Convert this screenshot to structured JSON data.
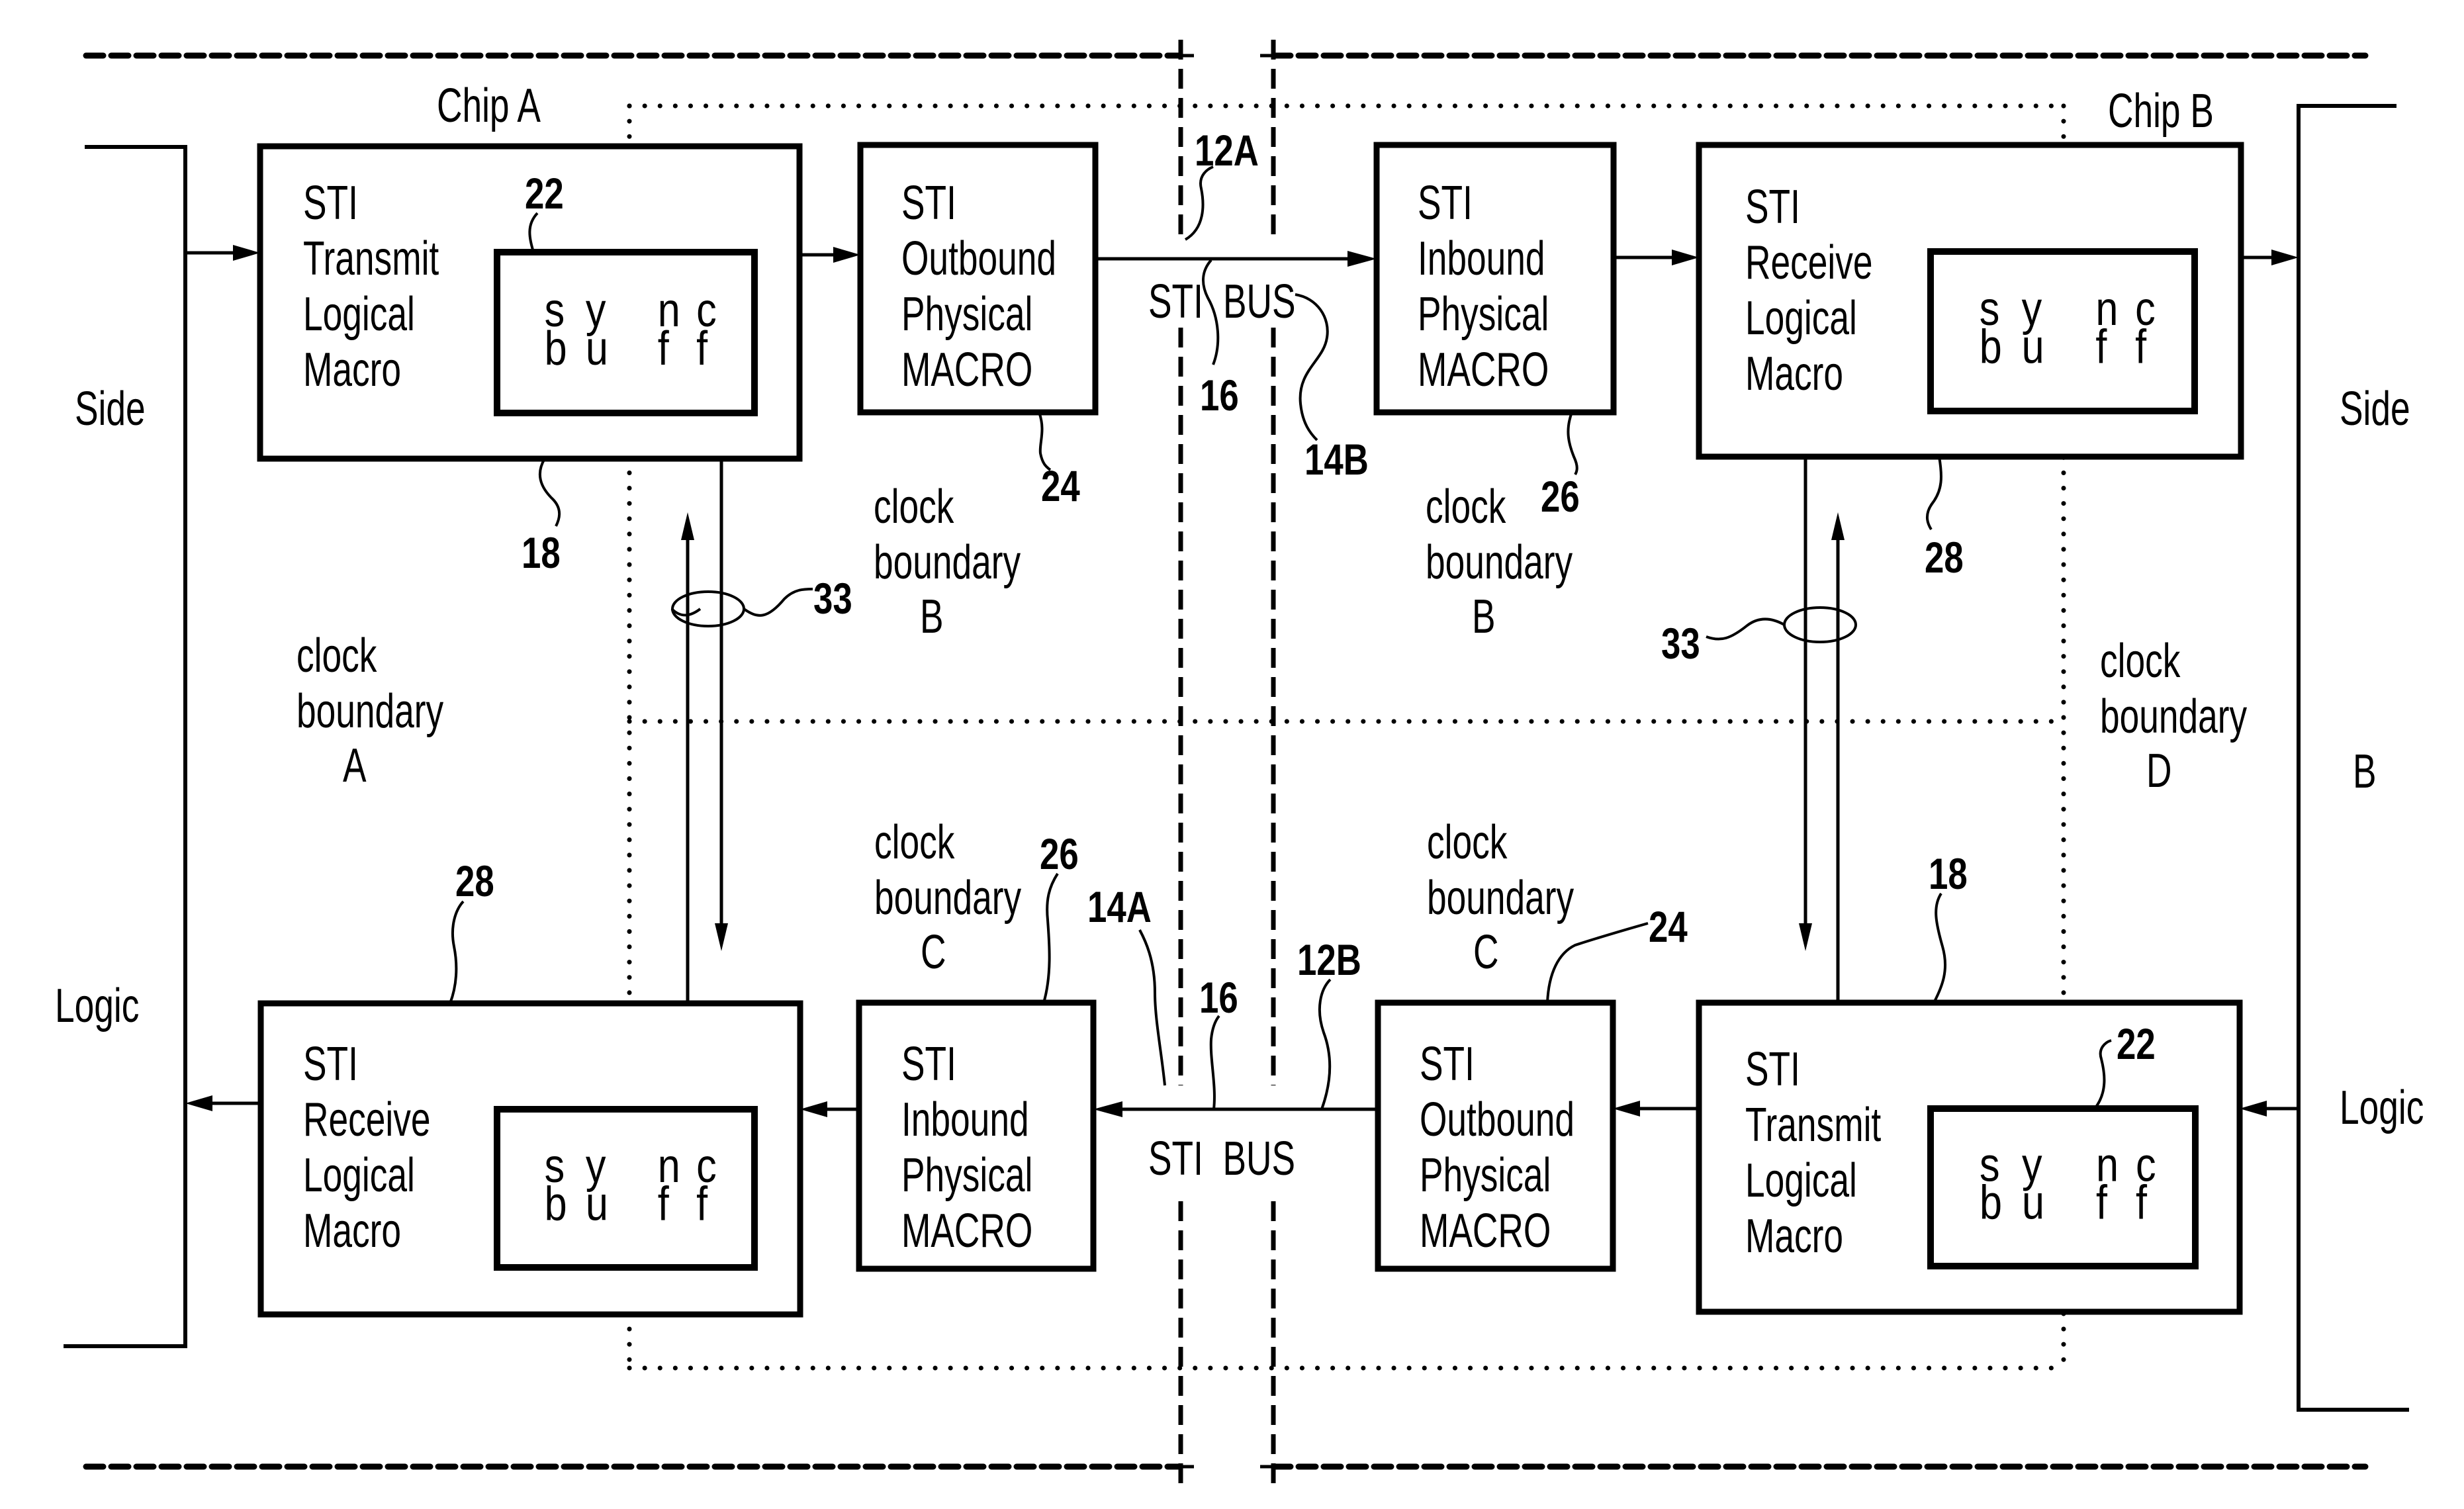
{
  "diagram": {
    "chips": {
      "chip_a": "Chip A",
      "chip_b": "Chip B"
    },
    "side_logic_left": {
      "side": "Side",
      "logic": "Logic"
    },
    "side_logic_right": {
      "side": "Side",
      "b": "B",
      "logic": "Logic"
    },
    "blocks": {
      "a_transmit": {
        "lines": [
          "STI",
          "Transmit",
          "Logical",
          "Macro"
        ],
        "ref": "22",
        "ref_box": "18"
      },
      "a_outbound": {
        "lines": [
          "STI",
          "Outbound",
          "Physical",
          "MACRO"
        ],
        "ref": "24"
      },
      "b_inbound": {
        "lines": [
          "STI",
          "Inbound",
          "Physical",
          "MACRO"
        ],
        "ref": "26"
      },
      "b_receive": {
        "lines": [
          "STI",
          "Receive",
          "Logical",
          "Macro"
        ],
        "ref": "28"
      },
      "a_receive": {
        "lines": [
          "STI",
          "Receive",
          "Logical",
          "Macro"
        ],
        "ref": "28"
      },
      "a_inbound": {
        "lines": [
          "STI",
          "Inbound",
          "Physical",
          "MACRO"
        ],
        "ref": "26"
      },
      "b_outbound": {
        "lines": [
          "STI",
          "Outbound",
          "Physical",
          "MACRO"
        ],
        "ref": "24"
      },
      "b_transmit": {
        "lines": [
          "STI",
          "Transmit",
          "Logical",
          "Macro"
        ],
        "ref": "22",
        "ref_box": "18"
      }
    },
    "sync_buffer": {
      "row1": [
        "s",
        "y",
        "n",
        "c"
      ],
      "row2": [
        "b",
        "u",
        "f",
        "f"
      ]
    },
    "bus": {
      "top_label_1": "STI",
      "top_label_2": "BUS",
      "bottom_label": "STI  BUS",
      "refs": {
        "top_12": "12A",
        "top_16": "16",
        "top_14": "14B",
        "bottom_14": "14A",
        "bottom_16": "16",
        "bottom_12": "12B"
      }
    },
    "clock_boundaries": {
      "a": [
        "clock",
        "boundary",
        "A"
      ],
      "b_left": [
        "clock",
        "boundary",
        "B"
      ],
      "b_right": [
        "clock",
        "boundary",
        "B"
      ],
      "c_left": [
        "clock",
        "boundary",
        "C"
      ],
      "c_right": [
        "clock",
        "boundary",
        "C"
      ],
      "d": [
        "clock",
        "boundary",
        "D"
      ]
    },
    "bundle_ref": "33"
  }
}
